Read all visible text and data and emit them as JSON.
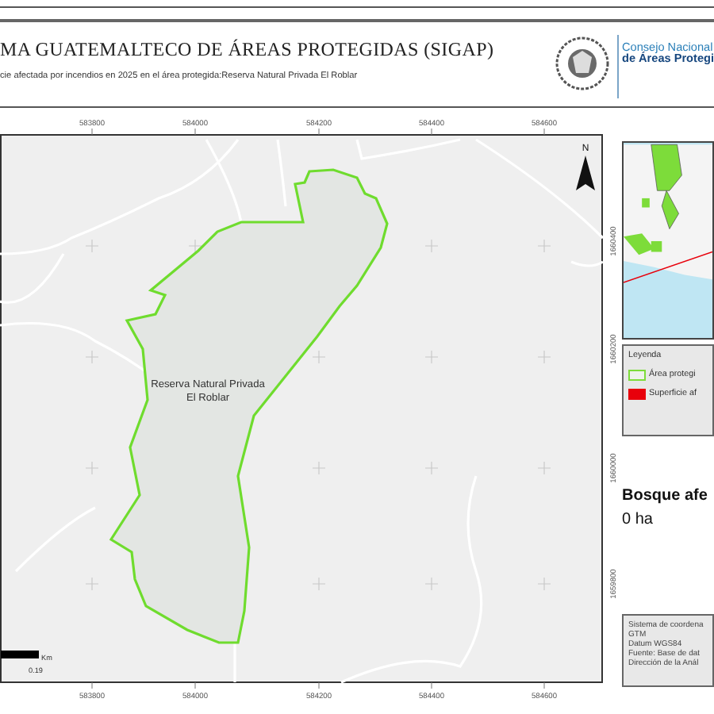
{
  "header": {
    "title": "MA GUATEMALTECO DE ÁREAS PROTEGIDAS (SIGAP)",
    "subtitle": "cie afectada por incendios en 2025 en el área protegida:Reserva Natural Privada El Roblar"
  },
  "logo": {
    "line_1": "Consejo Nacional",
    "line_2": "de Áreas Protegi"
  },
  "map": {
    "top_ticks": [
      "583800",
      "584000",
      "584200",
      "584400",
      "584600"
    ],
    "bottom_ticks": [
      "583800",
      "584000",
      "584200",
      "584400",
      "584600"
    ],
    "side_ticks": [
      "1660400",
      "1660200",
      "1660000",
      "1659800"
    ],
    "area_label": "Reserva Natural Privada El Roblar",
    "north_label": "N",
    "scale": {
      "unit": "Km",
      "value": "0.19"
    }
  },
  "legend": {
    "title": "Leyenda",
    "items": [
      {
        "label": "Área protegi",
        "kind": "outline",
        "color": "#7ddc3a"
      },
      {
        "label": "Superficie af",
        "kind": "fill",
        "color": "#e8000b"
      }
    ]
  },
  "summary": {
    "title": "Bosque afe",
    "value": "0 ha"
  },
  "info": [
    "Sistema de coordena",
    "GTM",
    "Datum WGS84",
    "Fuente: Base de dat",
    "Dirección de la Anál"
  ]
}
